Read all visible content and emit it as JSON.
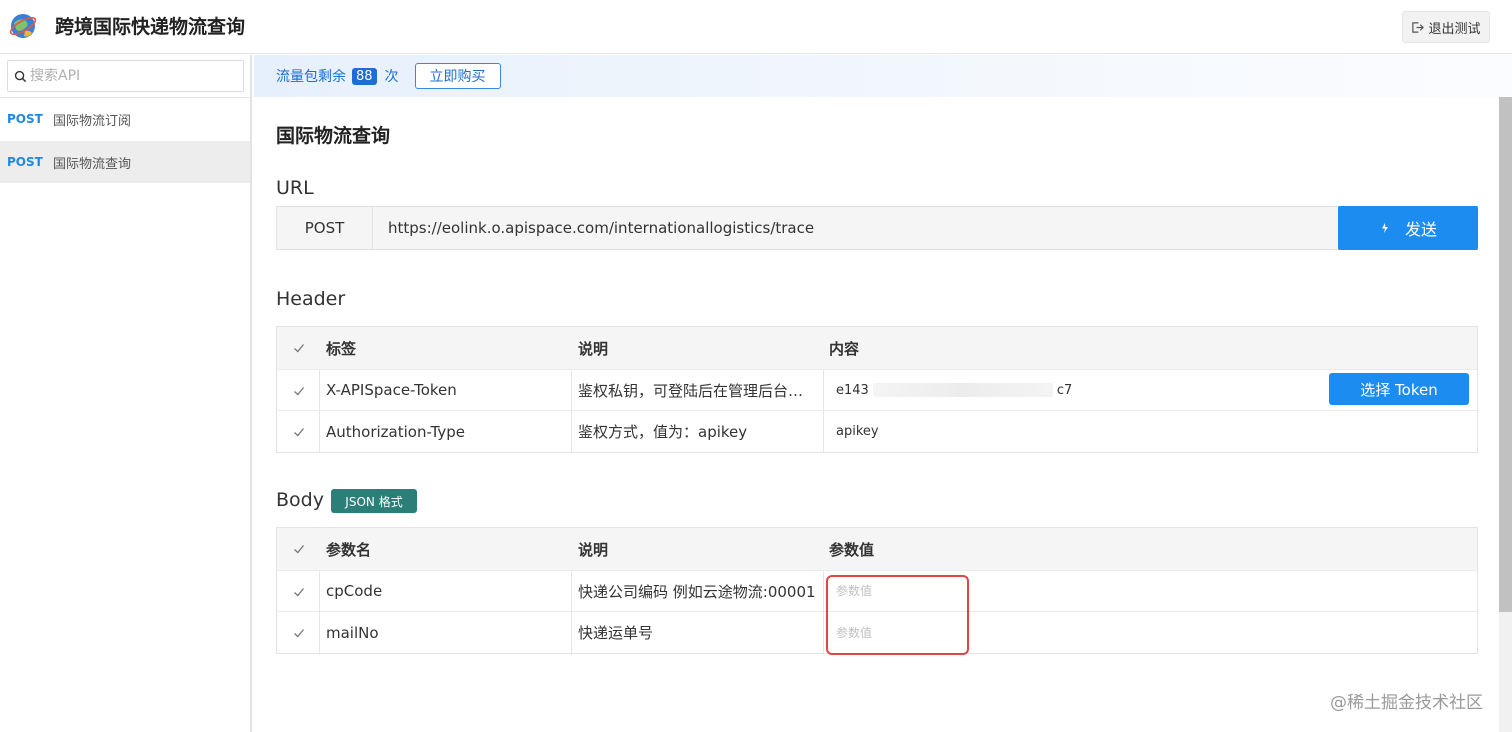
{
  "header": {
    "title": "跨境国际快递物流查询",
    "logout_label": "退出测试"
  },
  "sidebar": {
    "search_placeholder": "搜索API",
    "items": [
      {
        "method": "POST",
        "label": "国际物流订阅"
      },
      {
        "method": "POST",
        "label": "国际物流查询"
      }
    ]
  },
  "quota": {
    "prefix": "流量包剩余",
    "count": "88",
    "suffix": "次",
    "buy_label": "立即购买"
  },
  "main": {
    "title": "国际物流查询",
    "url_section": "URL",
    "method": "POST",
    "url": "https://eolink.o.apispace.com/internationallogistics/trace",
    "send_label": "发送",
    "header_section": "Header",
    "header_columns": [
      "标签",
      "说明",
      "内容"
    ],
    "header_rows": [
      {
        "name": "X-APISpace-Token",
        "desc": "鉴权私钥，可登陆后在管理后台…",
        "value_start": "e143",
        "value_end": "c7",
        "button": "选择 Token"
      },
      {
        "name": "Authorization-Type",
        "desc": "鉴权方式，值为：apikey",
        "value": "apikey"
      }
    ],
    "body_section": "Body",
    "body_badge": "JSON 格式",
    "body_columns": [
      "参数名",
      "说明",
      "参数值"
    ],
    "body_rows": [
      {
        "name": "cpCode",
        "desc": "快递公司编码 例如云途物流:00001",
        "placeholder": "参数值"
      },
      {
        "name": "mailNo",
        "desc": "快递运单号",
        "placeholder": "参数值"
      }
    ]
  },
  "watermark": "@稀土掘金技术社区",
  "colors": {
    "primary": "#1d8cf0",
    "badge": "#2b7f78",
    "highlight": "#e04646"
  }
}
